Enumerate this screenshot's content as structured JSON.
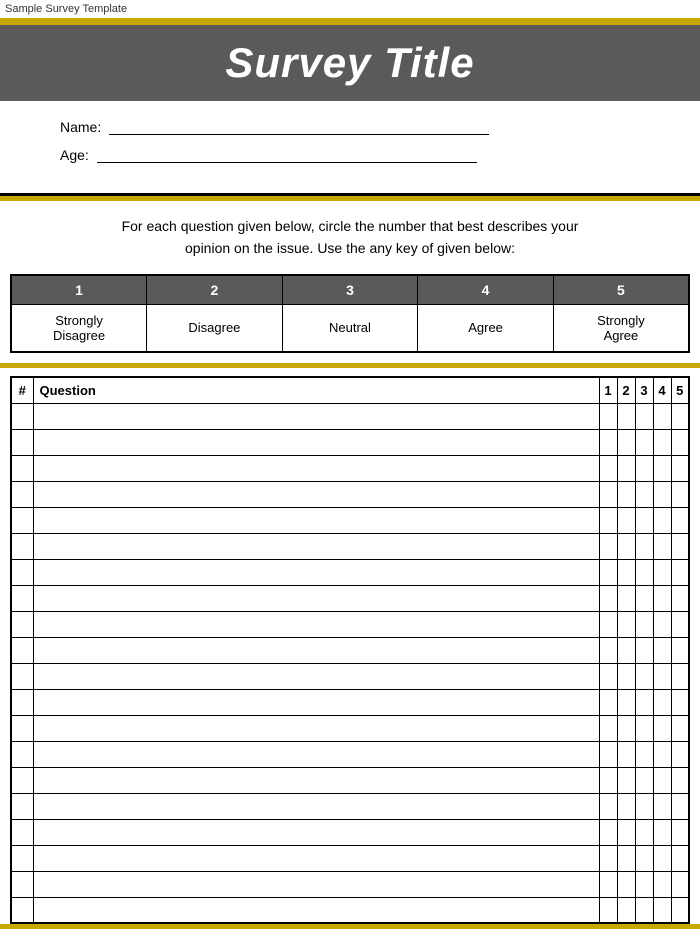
{
  "appBar": {
    "title": "Sample Survey Template"
  },
  "header": {
    "title": "Survey Title"
  },
  "infoSection": {
    "nameLine": "Name:",
    "ageLine": "Age:"
  },
  "instructions": {
    "line1": "For each question given below, circle the number that best describes your",
    "line2": "opinion on the issue. Use the any key of given below:"
  },
  "scaleTable": {
    "headers": [
      "1",
      "2",
      "3",
      "4",
      "5"
    ],
    "labels": [
      "Strongly Disagree",
      "Disagree",
      "Neutral",
      "Agree",
      "Strongly Agree"
    ]
  },
  "questionTable": {
    "headers": {
      "hash": "#",
      "question": "Question",
      "nums": [
        "1",
        "2",
        "3",
        "4",
        "5"
      ]
    },
    "rows": 20
  }
}
